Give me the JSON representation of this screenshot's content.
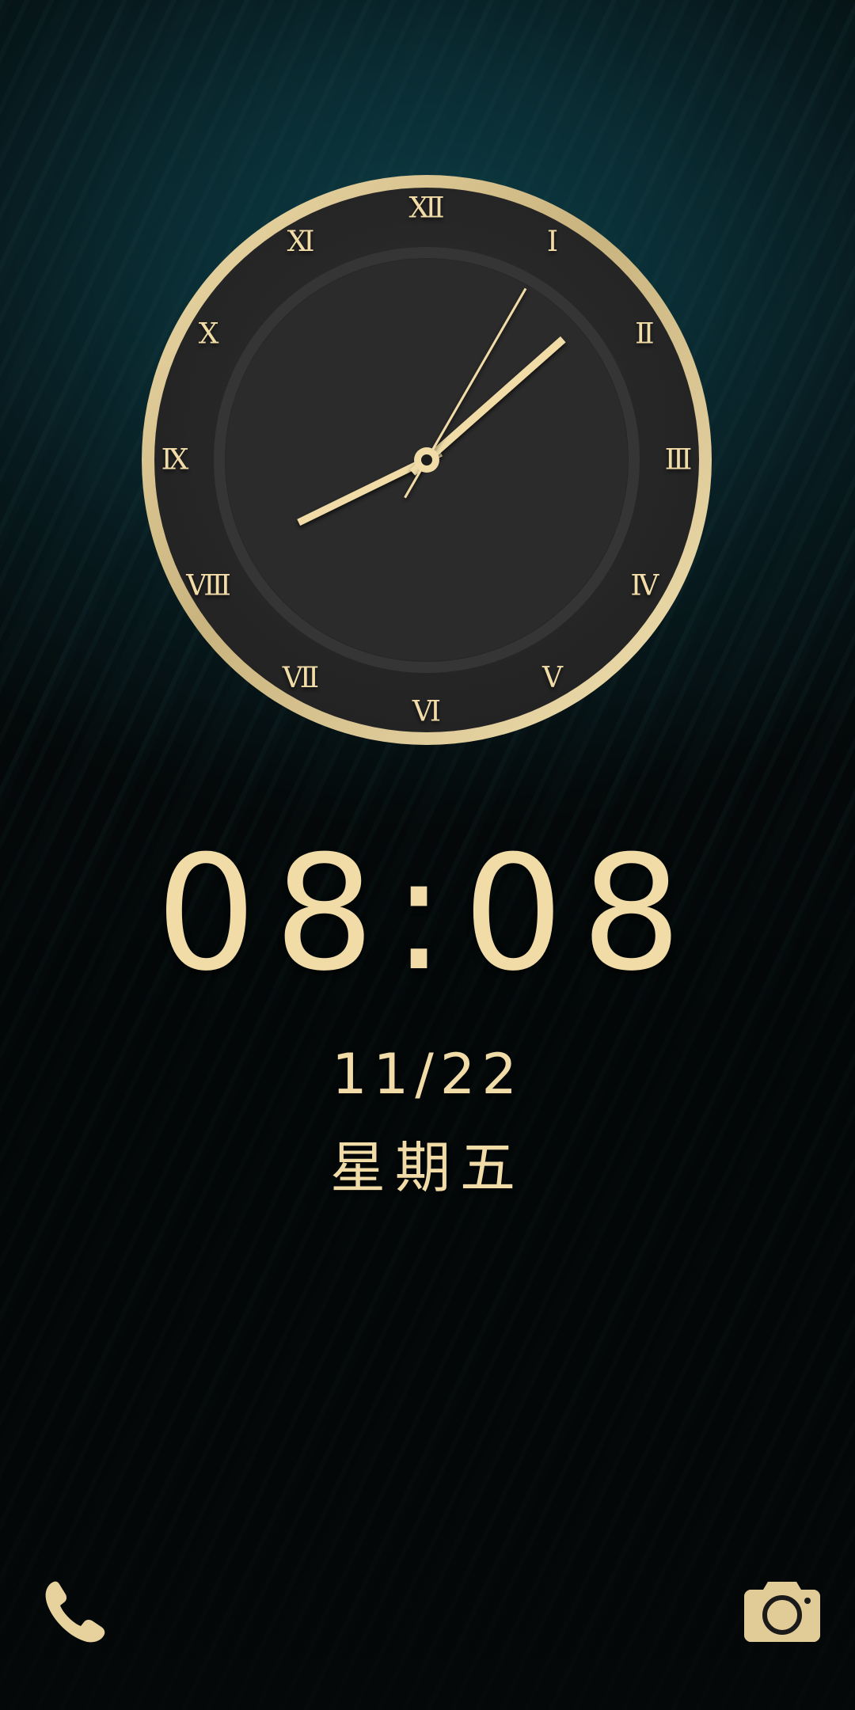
{
  "lockscreen": {
    "time": "08:08",
    "date": "11/22",
    "weekday": "星期五"
  },
  "analog_clock": {
    "hour": 8,
    "minute": 8,
    "second": 5,
    "numerals": [
      "Ⅻ",
      "Ⅰ",
      "Ⅱ",
      "Ⅲ",
      "Ⅳ",
      "Ⅴ",
      "Ⅵ",
      "Ⅶ",
      "Ⅷ",
      "Ⅸ",
      "Ⅹ",
      "Ⅺ"
    ]
  },
  "shortcuts": {
    "left_icon": "phone-icon",
    "right_icon": "camera-icon"
  },
  "colors": {
    "accent_gold": "#f1dca8",
    "bezel_gold": "#d8c38e",
    "face": "#2a2a2a",
    "background_teal": "#0c3c44"
  }
}
